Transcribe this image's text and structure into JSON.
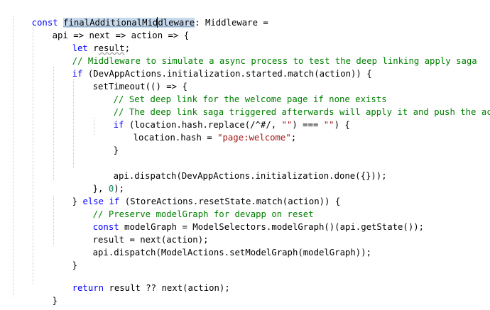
{
  "editor": {
    "lines": {
      "l1": {
        "kw": "const ",
        "name": "finalAdditionalMid",
        "name2": "dleware",
        "rest": ": Middleware ="
      },
      "l2": {
        "text": "api => next => action => {"
      },
      "l3": {
        "kw": "let ",
        "v1": "r",
        "v2": "esult",
        "rest": ";"
      },
      "l4": {
        "comment": "// Middleware to simulate a async process to test the deep linking apply saga"
      },
      "l5": {
        "kw": "if ",
        "rest": "(DevAppActions.initialization.started.match(action)) {"
      },
      "l6": {
        "text": "setTimeout(() => {"
      },
      "l7": {
        "comment": "// Set deep link for the welcome page if none exists"
      },
      "l8": {
        "comment": "// The deep link saga triggered afterwards will apply it and push the activity"
      },
      "l9": {
        "kw": "if ",
        "a": "(location.hash.replace(/^#/, ",
        "s1": "\"\"",
        "b": ") === ",
        "s2": "\"\"",
        "c": ") {"
      },
      "l10": {
        "text": "}"
      },
      "l11": {
        "text": "location.hash = ",
        "str": "\"page:welcome\"",
        "end": ";"
      },
      "l12": {
        "text": "api.dispatch(DevAppActions.initialization.done({}));"
      },
      "l13": {
        "a": "}, ",
        "num": "0",
        "b": ");"
      },
      "l14": {
        "a": "} ",
        "kw1": "else ",
        "kw2": "if ",
        "rest": "(StoreActions.resetState.match(action)) {"
      },
      "l15": {
        "comment": "// Preserve modelGraph for devapp on reset"
      },
      "l16": {
        "kw": "const ",
        "rest": "modelGraph = ModelSelectors.modelGraph()(api.getState());"
      },
      "l17": {
        "text": "result = next(action);"
      },
      "l18": {
        "text": "api.dispatch(ModelActions.setModelGraph(modelGraph));"
      },
      "l19": {
        "text": "}"
      },
      "l20": {
        "kw": "return ",
        "rest": "result ?? next(action);"
      },
      "l21": {
        "text": "}"
      }
    },
    "colors": {
      "keyword": "#0000ff",
      "comment": "#008000",
      "string": "#a31515",
      "number": "#098658",
      "highlight": "#c7d9ec"
    }
  }
}
